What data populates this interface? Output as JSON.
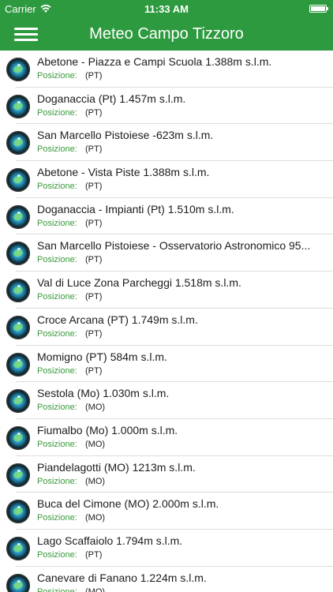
{
  "status_bar": {
    "carrier": "Carrier",
    "time": "11:33 AM"
  },
  "nav": {
    "title": "Meteo Campo Tizzoro"
  },
  "stations": [
    {
      "name": "Abetone - Piazza e Campi Scuola 1.388m s.l.m.",
      "position_label": "Posizione:",
      "position_value": "(PT)"
    },
    {
      "name": "Doganaccia (Pt) 1.457m s.l.m.",
      "position_label": "Posizione:",
      "position_value": "(PT)"
    },
    {
      "name": "San Marcello Pistoiese -623m s.l.m.",
      "position_label": "Posizione:",
      "position_value": "(PT)"
    },
    {
      "name": "Abetone - Vista Piste 1.388m s.l.m.",
      "position_label": "Posizione:",
      "position_value": "(PT)"
    },
    {
      "name": "Doganaccia - Impianti (Pt) 1.510m s.l.m.",
      "position_label": "Posizione:",
      "position_value": "(PT)"
    },
    {
      "name": "San Marcello Pistoiese - Osservatorio Astronomico 95...",
      "position_label": "Posizione:",
      "position_value": "(PT)"
    },
    {
      "name": "Val di Luce Zona Parcheggi 1.518m s.l.m.",
      "position_label": "Posizione:",
      "position_value": "(PT)"
    },
    {
      "name": "Croce Arcana (PT) 1.749m s.l.m.",
      "position_label": "Posizione:",
      "position_value": "(PT)"
    },
    {
      "name": "Momigno (PT) 584m s.l.m.",
      "position_label": "Posizione:",
      "position_value": "(PT)"
    },
    {
      "name": "Sestola (Mo) 1.030m s.l.m.",
      "position_label": "Posizione:",
      "position_value": "(MO)"
    },
    {
      "name": "Fiumalbo (Mo) 1.000m s.l.m.",
      "position_label": "Posizione:",
      "position_value": "(MO)"
    },
    {
      "name": "Piandelagotti (MO) 1213m s.l.m.",
      "position_label": "Posizione:",
      "position_value": "(MO)"
    },
    {
      "name": "Buca del Cimone (MO) 2.000m s.l.m.",
      "position_label": "Posizione:",
      "position_value": "(MO)"
    },
    {
      "name": "Lago Scaffaiolo 1.794m s.l.m.",
      "position_label": "Posizione:",
      "position_value": "(PT)"
    },
    {
      "name": "Canevare di Fanano 1.224m s.l.m.",
      "position_label": "Posizione:",
      "position_value": "(MO)"
    }
  ]
}
